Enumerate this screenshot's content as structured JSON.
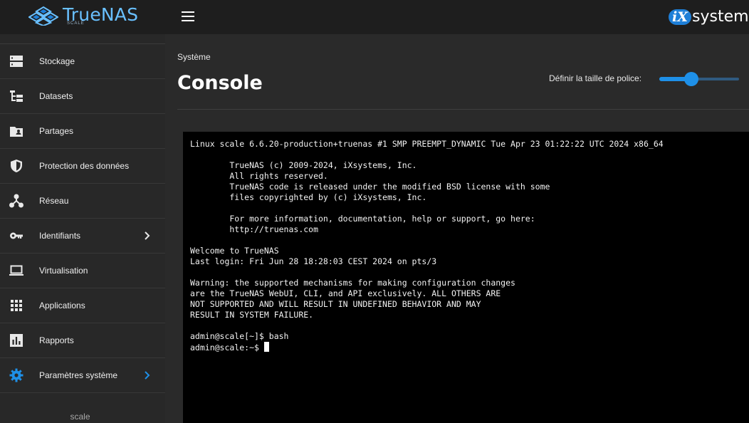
{
  "brand": {
    "name": "TrueNAS",
    "edition": "SCALE",
    "vendor_prefix": "iX",
    "vendor_word": "systems"
  },
  "header": {
    "menu_icon": "menu-icon"
  },
  "sidebar": {
    "items": [
      {
        "label": "Stockage",
        "icon": "storage-icon",
        "active": false,
        "has_children": false
      },
      {
        "label": "Datasets",
        "icon": "datasets-tree-icon",
        "active": false,
        "has_children": false
      },
      {
        "label": "Partages",
        "icon": "shared-folder-icon",
        "active": false,
        "has_children": false
      },
      {
        "label": "Protection des données",
        "icon": "shield-icon",
        "active": false,
        "has_children": false
      },
      {
        "label": "Réseau",
        "icon": "network-icon",
        "active": false,
        "has_children": false
      },
      {
        "label": "Identifiants",
        "icon": "key-icon",
        "active": false,
        "has_children": true
      },
      {
        "label": "Virtualisation",
        "icon": "laptop-icon",
        "active": false,
        "has_children": false
      },
      {
        "label": "Applications",
        "icon": "apps-grid-icon",
        "active": false,
        "has_children": false
      },
      {
        "label": "Rapports",
        "icon": "chart-icon",
        "active": false,
        "has_children": false
      },
      {
        "label": "Paramètres système",
        "icon": "gear-icon",
        "active": true,
        "has_children": true
      }
    ],
    "hostname": "scale"
  },
  "page": {
    "breadcrumb": "Système",
    "title": "Console",
    "font_size_label": "Définir la taille de police:",
    "font_size_slider_fraction": 0.4
  },
  "terminal": {
    "text": "Linux scale 6.6.20-production+truenas #1 SMP PREEMPT_DYNAMIC Tue Apr 23 01:22:22 UTC 2024 x86_64\n\n        TrueNAS (c) 2009-2024, iXsystems, Inc.\n        All rights reserved.\n        TrueNAS code is released under the modified BSD license with some\n        files copyrighted by (c) iXsystems, Inc.\n\n        For more information, documentation, help or support, go here:\n        http://truenas.com\n\nWelcome to TrueNAS\nLast login: Fri Jun 28 18:28:03 CEST 2024 on pts/3\n\nWarning: the supported mechanisms for making configuration changes\nare the TrueNAS WebUI, CLI, and API exclusively. ALL OTHERS ARE\nNOT SUPPORTED AND WILL RESULT IN UNDEFINED BEHAVIOR AND MAY\nRESULT IN SYSTEM FAILURE.\n\nadmin@scale[~]$ bash\n",
    "prompt": "admin@scale:~$ "
  },
  "colors": {
    "accent": "#1e90e8",
    "brand": "#69c0ff",
    "sidebar_bg": "#282828",
    "main_bg": "#2a2a2a",
    "terminal_bg": "#000000"
  }
}
